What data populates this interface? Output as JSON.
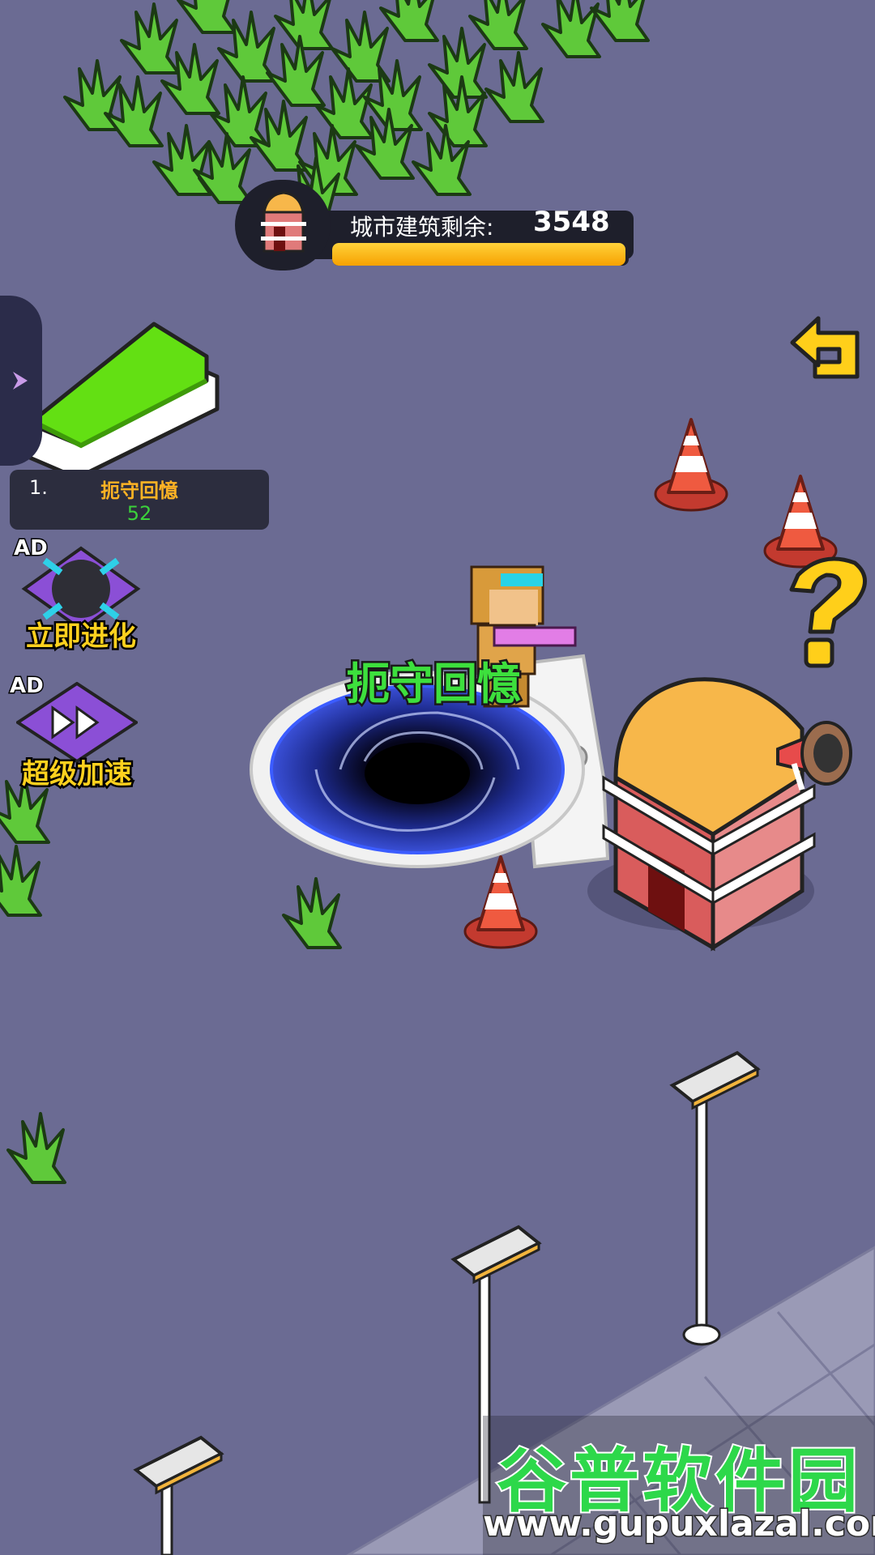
{
  "hud": {
    "label": "城市建筑剩余:",
    "remaining": "3548",
    "progress": 0.99,
    "icon": "building-icon"
  },
  "leaderboard": {
    "rank": "1.",
    "name": "扼守回憶",
    "score": "52"
  },
  "buttons": {
    "evolve": {
      "ad_tag": "AD",
      "label": "立即进化",
      "icon": "expand-arrows-icon"
    },
    "speed": {
      "ad_tag": "AD",
      "label": "超级加速",
      "icon": "fast-forward-icon"
    },
    "back_icon": "return-arrow-icon",
    "help_icon": "question-mark-icon",
    "side_tab_icon": "chevron-right-icon",
    "announce_icon": "megaphone-icon"
  },
  "player": {
    "name": "扼守回憶"
  },
  "watermark": {
    "title": "谷普软件园",
    "url": "www.gupuxlazal.com"
  },
  "colors": {
    "ground": "#6b6b93",
    "accent": "#ffd11e",
    "bar_fill": "#f7a100",
    "name_green": "#3de03d"
  }
}
